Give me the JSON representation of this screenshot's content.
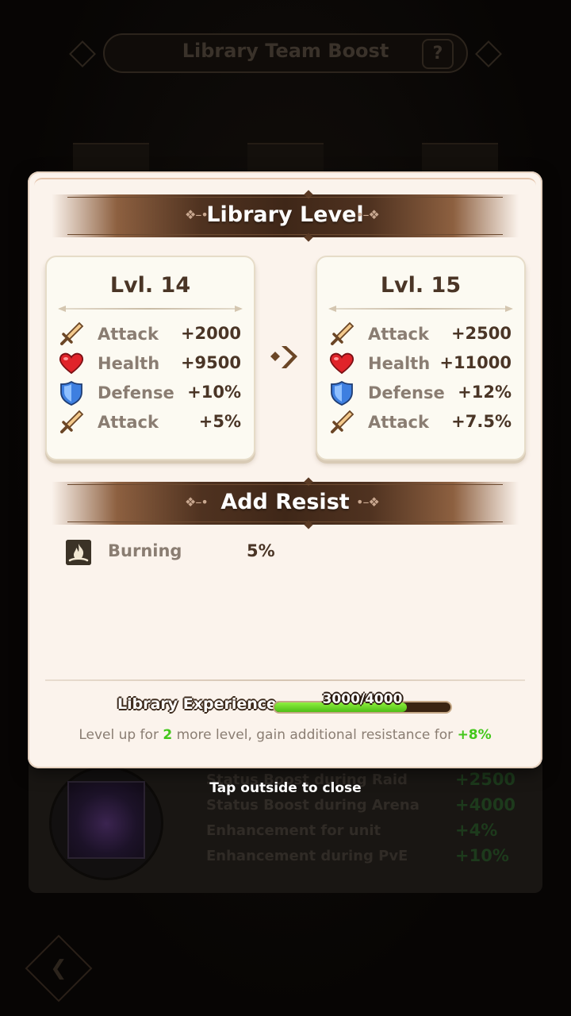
{
  "background": {
    "title": "Library Team Boost",
    "help_label": "?",
    "stats": [
      {
        "label": "Status Boost during Raid",
        "value": "+2500"
      },
      {
        "label": "Status Boost during Arena",
        "value": "+4000"
      },
      {
        "label": "Enhancement for unit",
        "value": "+4%"
      },
      {
        "label": "Enhancement during PvE",
        "value": "+10%"
      }
    ]
  },
  "dialog": {
    "library_level_title": "Library Level",
    "current": {
      "title": "Lvl. 14",
      "stats": [
        {
          "icon": "sword-icon",
          "label": "Attack",
          "value": "+2000"
        },
        {
          "icon": "heart-icon",
          "label": "Health",
          "value": "+9500"
        },
        {
          "icon": "shield-icon",
          "label": "Defense",
          "value": "+10%"
        },
        {
          "icon": "sword-icon",
          "label": "Attack",
          "value": "+5%"
        }
      ]
    },
    "next": {
      "title": "Lvl. 15",
      "stats": [
        {
          "icon": "sword-icon",
          "label": "Attack",
          "value": "+2500"
        },
        {
          "icon": "heart-icon",
          "label": "Health",
          "value": "+11000"
        },
        {
          "icon": "shield-icon",
          "label": "Defense",
          "value": "+12%"
        },
        {
          "icon": "sword-icon",
          "label": "Attack",
          "value": "+7.5%"
        }
      ]
    },
    "add_resist_title": "Add Resist",
    "resist": {
      "icon": "burning-icon",
      "label": "Burning",
      "value": "5%"
    },
    "experience": {
      "label": "Library Experience",
      "text": "3000/4000",
      "current": 3000,
      "max": 4000
    },
    "level_up": {
      "prefix": "Level up for ",
      "levels": "2",
      "middle": " more level, gain additional resistance for ",
      "bonus": "+8%"
    }
  },
  "tap_outside": "Tap outside to close",
  "colors": {
    "accent_green": "#43c71b",
    "banner_brown": "#3f2718",
    "text_brown": "#4a3526",
    "label_grey": "#8a7d72"
  }
}
